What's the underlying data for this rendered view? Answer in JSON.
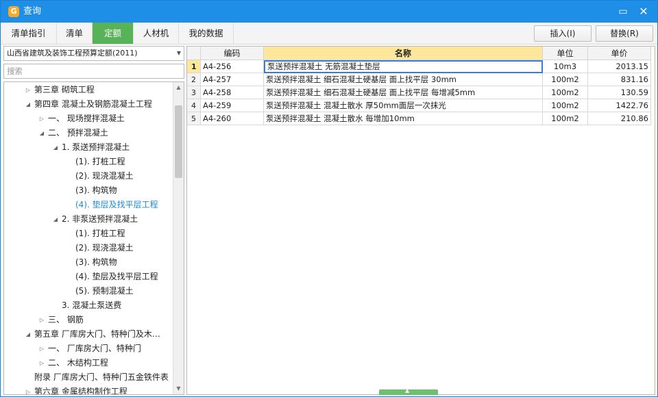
{
  "window": {
    "title": "查询",
    "minimize_icon": "minimize-icon",
    "close_icon": "close-icon"
  },
  "tabs": [
    {
      "label": "清单指引",
      "active": false
    },
    {
      "label": "清单",
      "active": false
    },
    {
      "label": "定额",
      "active": true
    },
    {
      "label": "人材机",
      "active": false
    },
    {
      "label": "我的数据",
      "active": false
    }
  ],
  "toolbar": {
    "insert_label": "插入(I)",
    "replace_label": "替换(R)"
  },
  "left": {
    "quota_select": "山西省建筑及装饰工程预算定额(2011)",
    "search_placeholder": "搜索",
    "tree": [
      {
        "label": "第三章  砌筑工程",
        "expand": "collapsed"
      },
      {
        "label": "第四章  混凝土及钢筋混凝土工程",
        "expand": "expanded"
      },
      {
        "label": "一、  现场搅拌混凝土",
        "expand": "collapsed"
      },
      {
        "label": "二、  预拌混凝土",
        "expand": "expanded"
      },
      {
        "label": "1.  泵送预拌混凝土",
        "expand": "expanded"
      },
      {
        "label": "(1).  打桩工程",
        "expand": "leaf"
      },
      {
        "label": "(2).  现浇混凝土",
        "expand": "leaf"
      },
      {
        "label": "(3).  构筑物",
        "expand": "leaf"
      },
      {
        "label": "(4).  垫层及找平层工程",
        "expand": "leaf",
        "selected": true
      },
      {
        "label": "2.  非泵送预拌混凝土",
        "expand": "expanded"
      },
      {
        "label": "(1).  打桩工程",
        "expand": "leaf"
      },
      {
        "label": "(2).  现浇混凝土",
        "expand": "leaf"
      },
      {
        "label": "(3).  构筑物",
        "expand": "leaf"
      },
      {
        "label": "(4).  垫层及找平层工程",
        "expand": "leaf"
      },
      {
        "label": "(5).  预制混凝土",
        "expand": "leaf"
      },
      {
        "label": "3.  混凝土泵送费",
        "expand": "leaf"
      },
      {
        "label": "三、  钢筋",
        "expand": "collapsed"
      },
      {
        "label": "第五章  厂库房大门、特种门及木…",
        "expand": "expanded"
      },
      {
        "label": "一、  厂库房大门、特种门",
        "expand": "collapsed"
      },
      {
        "label": "二、  木结构工程",
        "expand": "collapsed"
      },
      {
        "label": "附录  厂库房大门、特种门五金铁件表",
        "expand": "leaf"
      },
      {
        "label": "第六章  金属结构制作工程",
        "expand": "collapsed"
      }
    ]
  },
  "grid": {
    "columns": {
      "code": "编码",
      "name": "名称",
      "unit": "单位",
      "price": "单价"
    },
    "rows": [
      {
        "n": "1",
        "code": "A4-256",
        "name": "泵送预拌混凝土  无筋混凝土垫层",
        "unit": "10m3",
        "price": "2013.15",
        "selected": true
      },
      {
        "n": "2",
        "code": "A4-257",
        "name": "泵送预拌混凝土  细石混凝土硬基层  面上找平层  30mm",
        "unit": "100m2",
        "price": "831.16"
      },
      {
        "n": "3",
        "code": "A4-258",
        "name": "泵送预拌混凝土  细石混凝土硬基层  面上找平层  每增减5mm",
        "unit": "100m2",
        "price": "130.59"
      },
      {
        "n": "4",
        "code": "A4-259",
        "name": "泵送预拌混凝土  混凝土散水  厚50mm面层一次抹光",
        "unit": "100m2",
        "price": "1422.76"
      },
      {
        "n": "5",
        "code": "A4-260",
        "name": "泵送预拌混凝土  混凝土散水  每增加10mm",
        "unit": "100m2",
        "price": "210.86"
      }
    ]
  },
  "colors": {
    "titlebar": "#1e8ee6",
    "active_tab": "#58b358",
    "header_highlight": "#fde79a",
    "tree_selected": "#1c8ad8"
  }
}
